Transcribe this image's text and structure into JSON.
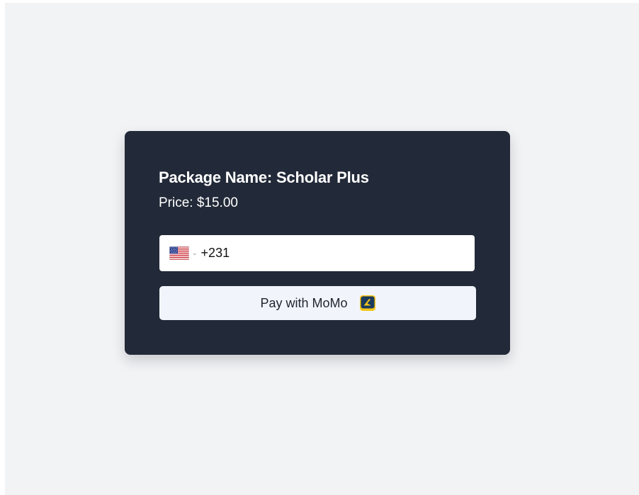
{
  "card": {
    "title": "Package Name: Scholar Plus",
    "price": "Price: $15.00"
  },
  "phone": {
    "country_flag": "us-flag-icon",
    "country_chevron": "⌄",
    "value": "+231"
  },
  "pay": {
    "label": "Pay with MoMo",
    "icon": "momo-icon"
  },
  "colors": {
    "page_background": "#f2f3f5",
    "card_background": "#222938",
    "button_background": "#f1f5fb",
    "momo_badge": "#1b3a5c",
    "momo_accent": "#f5c518"
  }
}
